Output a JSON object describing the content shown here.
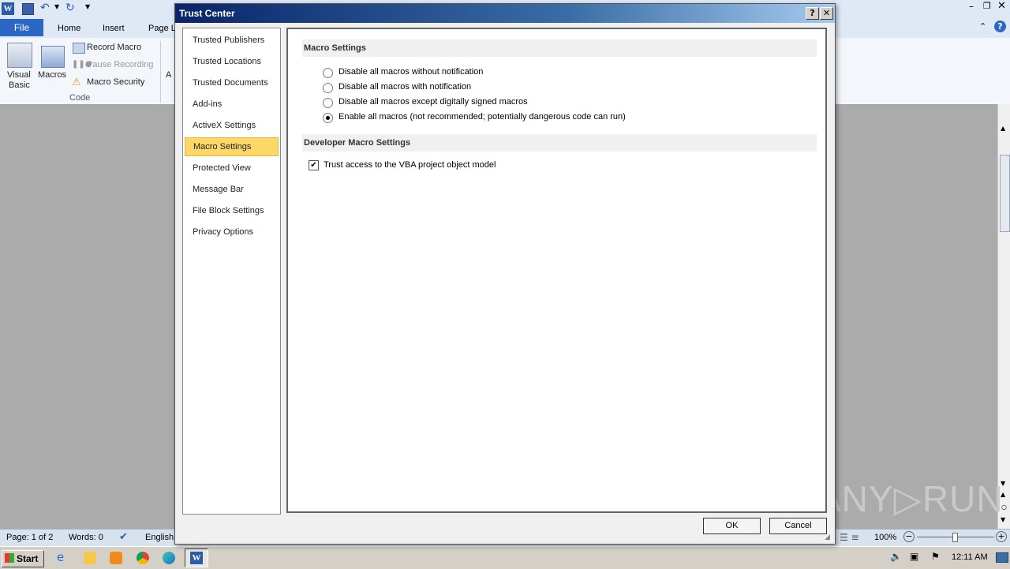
{
  "word": {
    "tabs": [
      "File",
      "Home",
      "Insert",
      "Page L"
    ],
    "ribbon": {
      "visual_basic_line1": "Visual",
      "visual_basic_line2": "Basic",
      "macros": "Macros",
      "record_macro": "Record Macro",
      "pause_recording": "Pause Recording",
      "macro_security": "Macro Security",
      "group_code": "Code",
      "partial": "A"
    },
    "status": {
      "page": "Page: 1 of 2",
      "words": "Words: 0",
      "language": "English",
      "zoom": "100%"
    }
  },
  "dialog": {
    "title": "Trust Center",
    "help_btn": "?",
    "close_btn": "✕",
    "nav": [
      "Trusted Publishers",
      "Trusted Locations",
      "Trusted Documents",
      "Add-ins",
      "ActiveX Settings",
      "Macro Settings",
      "Protected View",
      "Message Bar",
      "File Block Settings",
      "Privacy Options"
    ],
    "selected_nav": "Macro Settings",
    "macro_header": "Macro Settings",
    "macro_options": [
      "Disable all macros without notification",
      "Disable all macros with notification",
      "Disable all macros except digitally signed macros",
      "Enable all macros (not recommended; potentially dangerous code can run)"
    ],
    "selected_option": 3,
    "dev_header": "Developer Macro Settings",
    "vba_checkbox": "Trust access to the VBA project object model",
    "vba_checked": true,
    "ok": "OK",
    "cancel": "Cancel"
  },
  "taskbar": {
    "start": "Start",
    "clock": "12:11 AM"
  },
  "watermark": "ANY▷RUN"
}
